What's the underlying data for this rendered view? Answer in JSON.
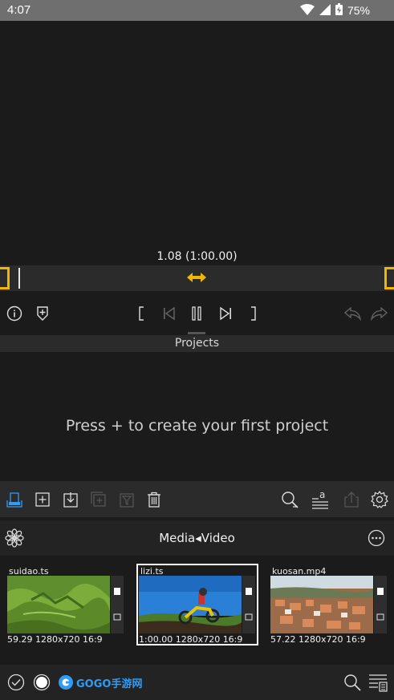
{
  "status": {
    "time": "4:07",
    "battery": "75%"
  },
  "player": {
    "timecode": "1.08 (1:00.00)"
  },
  "projects": {
    "header": "Projects",
    "empty_message": "Press + to create your first project"
  },
  "media": {
    "title": "Media◂Video",
    "clips": [
      {
        "name": "suidao.ts",
        "meta": "59.29 1280x720 16:9",
        "selected": false
      },
      {
        "name": "lizi.ts",
        "meta": "1:00.00 1280x720 16:9",
        "selected": true
      },
      {
        "name": "kuosan.mp4",
        "meta": "57.22 1280x720 16:9",
        "selected": false
      }
    ]
  },
  "logo": {
    "text": "GOGO手游网"
  },
  "colors": {
    "accent": "#f2b600",
    "active_icon": "#2f9cf5",
    "background": "#1b1b1b",
    "panel": "#2b2b2b"
  },
  "icons": {
    "status": [
      "wifi-icon",
      "signal-icon",
      "battery-icon"
    ],
    "controls": [
      "info-icon",
      "add-marker-icon",
      "mark-in-icon",
      "skip-start-icon",
      "pause-icon",
      "skip-end-icon",
      "mark-out-icon",
      "undo-icon",
      "redo-icon"
    ],
    "toolbar": [
      "import-icon",
      "new-project-icon",
      "download-icon",
      "duplicate-icon",
      "filter-icon",
      "delete-icon",
      "search-icon",
      "sort-icon",
      "share-icon",
      "settings-icon"
    ],
    "media": [
      "flower-icon",
      "more-icon"
    ],
    "bottom": [
      "check-icon",
      "record-icon",
      "search-icon",
      "list-icon"
    ]
  }
}
